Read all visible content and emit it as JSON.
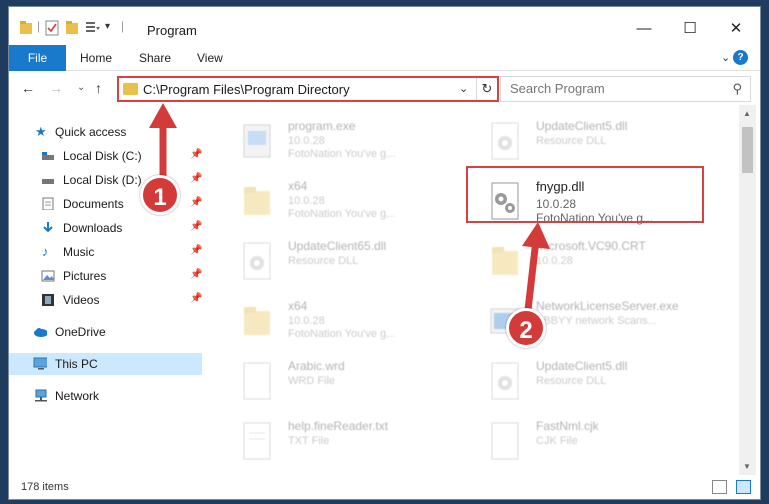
{
  "window": {
    "title": "Program"
  },
  "ribbon": {
    "file": "File",
    "home": "Home",
    "share": "Share",
    "view": "View"
  },
  "address": {
    "path": "C:\\Program Files\\Program Directory"
  },
  "search": {
    "placeholder": "Search Program"
  },
  "nav": {
    "quick_access": "Quick access",
    "items": [
      {
        "label": "Local Disk (C:)"
      },
      {
        "label": "Local Disk (D:)"
      },
      {
        "label": "Documents"
      },
      {
        "label": "Downloads"
      },
      {
        "label": "Music"
      },
      {
        "label": "Pictures"
      },
      {
        "label": "Videos"
      }
    ],
    "onedrive": "OneDrive",
    "this_pc": "This PC",
    "network": "Network"
  },
  "files": [
    {
      "name": "program.exe",
      "sub1": "10.0.28",
      "sub2": "FotoNation You've g..."
    },
    {
      "name": "UpdateClient5.dll",
      "sub1": "Resource DLL",
      "sub2": ""
    },
    {
      "name": "x64",
      "sub1": "10.0.28",
      "sub2": "FotoNation You've g..."
    },
    {
      "name": "fnygp.dll",
      "sub1": "10.0.28",
      "sub2": "FotoNation You've g..."
    },
    {
      "name": "UpdateClient65.dll",
      "sub1": "Resource DLL",
      "sub2": ""
    },
    {
      "name": "Microsoft.VC90.CRT",
      "sub1": "10.0.28",
      "sub2": ""
    },
    {
      "name": "x64",
      "sub1": "10.0.28",
      "sub2": "FotoNation You've g..."
    },
    {
      "name": "NetworkLicenseServer.exe",
      "sub1": "ABBYY network Scans...",
      "sub2": ""
    },
    {
      "name": "Arabic.wrd",
      "sub1": "WRD File",
      "sub2": ""
    },
    {
      "name": "UpdateClient5.dll",
      "sub1": "Resource DLL",
      "sub2": ""
    },
    {
      "name": "help.fineReader.txt",
      "sub1": "TXT File",
      "sub2": ""
    },
    {
      "name": "FastNml.cjk",
      "sub1": "CJK File",
      "sub2": ""
    }
  ],
  "callouts": {
    "one": "1",
    "two": "2"
  },
  "status": {
    "count": "178 items"
  },
  "colors": {
    "accent": "#1979ca",
    "highlight": "#d94040",
    "selected": "#cce8ff",
    "folder": "#e8c04a"
  }
}
